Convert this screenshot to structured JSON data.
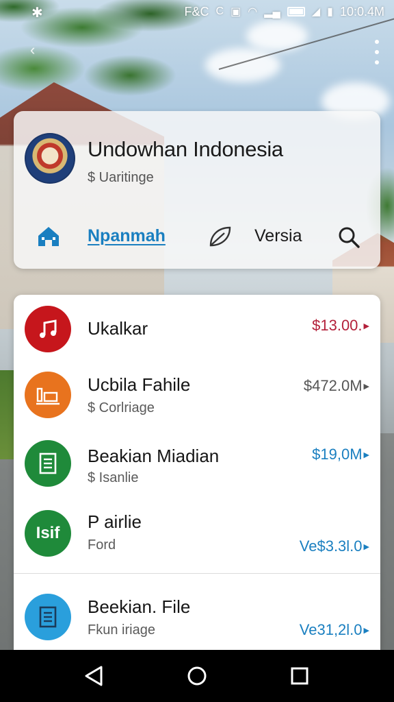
{
  "status_bar": {
    "left_icon": "gear-icon",
    "carrier_text": "F&C",
    "time": "10:0.4M",
    "icons": [
      "sync-icon",
      "square-icon",
      "wifi-icon",
      "signal-icon",
      "battery-icon",
      "signal-icon",
      "battery-icon"
    ]
  },
  "top_bar": {
    "back_icon": "chevron-left-icon",
    "menu_icon": "kebab-menu-icon"
  },
  "header": {
    "title": "Undowhan Indonesia",
    "subtitle": "$ Uaritinge",
    "emblem_icon": "emblem-icon"
  },
  "nav": {
    "home_icon": "home-icon",
    "active_tab": "Npanmah",
    "leaf_icon": "leaf-icon",
    "version_tab": "Versia",
    "search_icon": "search-icon"
  },
  "colors": {
    "accent": "#1a7fc0",
    "red": "#c6161c",
    "orange": "#e8731e",
    "green": "#1f8a3a",
    "blue": "#2a9fdc",
    "amount_red": "#b3203a",
    "amount_gray": "#555555",
    "amount_blue": "#1a7fc0"
  },
  "list": [
    {
      "title": "Ukalkar",
      "subtitle": "",
      "amount": "$13.00.",
      "icon": "music-note-icon",
      "icon_color": "#c6161c",
      "amount_color": "#b3203a"
    },
    {
      "title": "Ucbila Fahile",
      "subtitle": "$ Corlriage",
      "amount": "$472.0M",
      "icon": "building-icon",
      "icon_color": "#e8731e",
      "amount_color": "#555555"
    },
    {
      "title": "Beakian Miadian",
      "subtitle": "$ Isanlie",
      "amount": "$19,0M",
      "icon": "document-icon",
      "icon_color": "#1f8a3a",
      "amount_color": "#1a7fc0"
    },
    {
      "title": "P airlie",
      "subtitle": "Ford",
      "amount": "Ve$3.3l.0",
      "icon": "isif-icon",
      "icon_text": "Isif",
      "icon_color": "#1f8a3a",
      "amount_color": "#1a7fc0"
    },
    {
      "title": "Beekian. File",
      "subtitle": "Fkun iriage",
      "amount": "Ve31,2l.0",
      "icon": "document-icon",
      "icon_color": "#2a9fdc",
      "amount_color": "#1a7fc0"
    }
  ],
  "system_nav": {
    "back": "back-triangle-icon",
    "home": "home-circle-icon",
    "recents": "recents-square-icon"
  }
}
